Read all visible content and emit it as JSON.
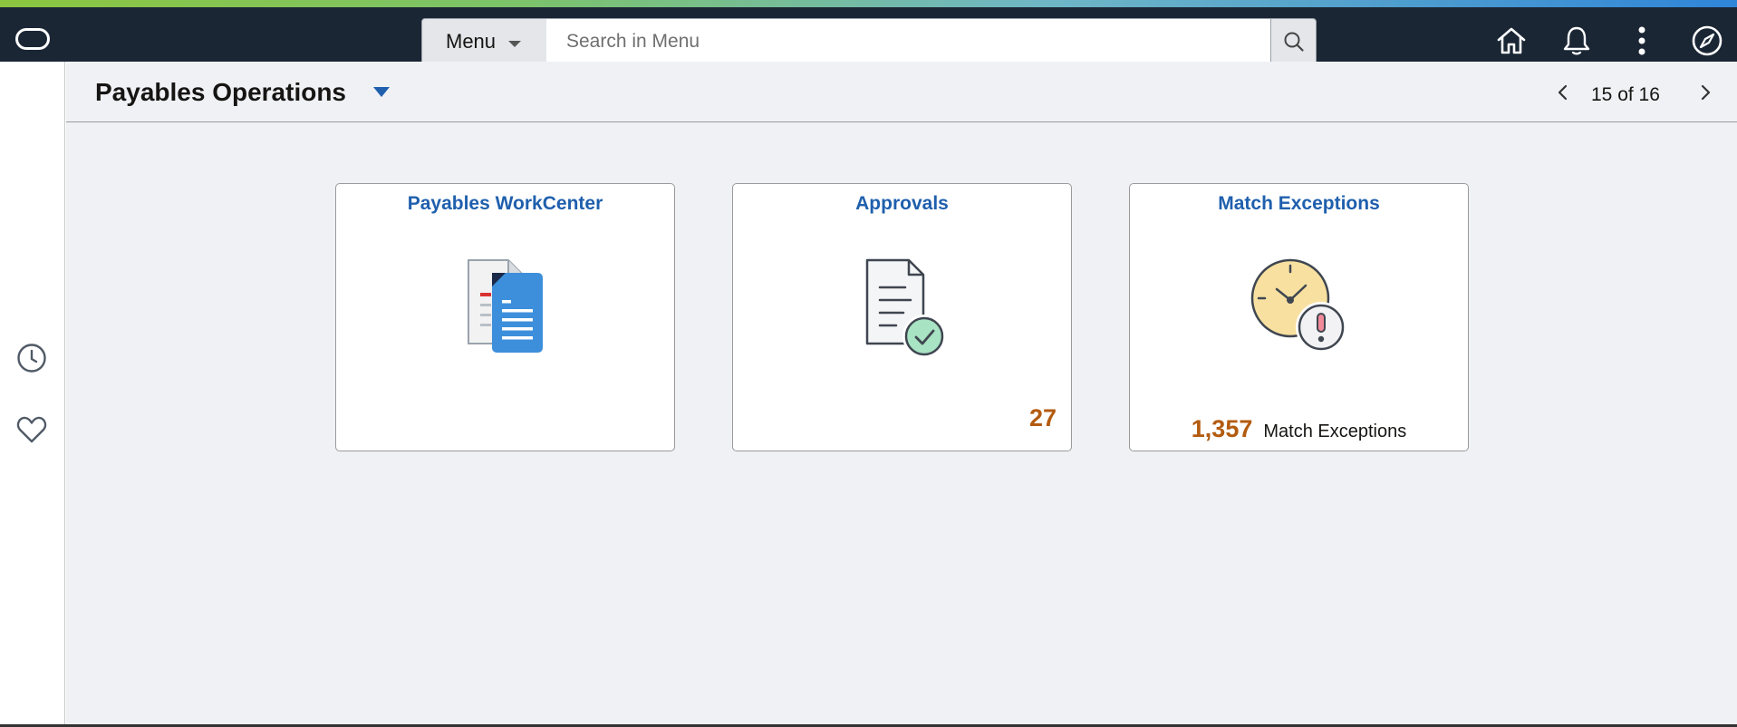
{
  "header": {
    "menu_label": "Menu",
    "search_placeholder": "Search in Menu",
    "icons": [
      "logo-icon",
      "search-icon",
      "home-icon",
      "bell-icon",
      "more-vertical-icon",
      "compass-icon"
    ]
  },
  "sidebar": {
    "icons": [
      "recent-clock-icon",
      "favorites-heart-icon"
    ]
  },
  "page": {
    "title": "Payables Operations",
    "pager": "15 of 16"
  },
  "tiles": [
    {
      "title": "Payables WorkCenter",
      "icon": "documents-icon"
    },
    {
      "title": "Approvals",
      "icon": "approved-document-icon",
      "count": "27"
    },
    {
      "title": "Match Exceptions",
      "icon": "clock-alert-icon",
      "count": "1,357",
      "count_label": "Match Exceptions"
    }
  ],
  "colors": {
    "header_bg": "#1b2635",
    "page_bg": "#eff1f5",
    "tile_title": "#1f5fad",
    "count": "#b35b0f"
  }
}
